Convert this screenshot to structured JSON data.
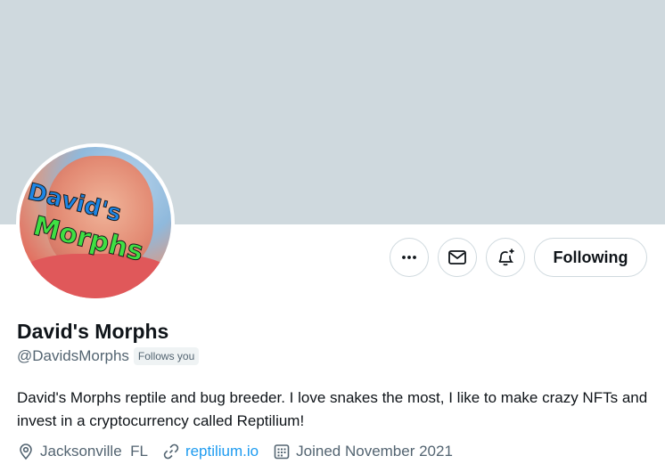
{
  "profile": {
    "display_name": "David's Morphs",
    "handle": "@DavidsMorphs",
    "follows_you_badge": "Follows you",
    "bio": "David's Morphs reptile and bug breeder. I love snakes the most, I like to make crazy NFTs and invest in a cryptocurrency called Reptilium!",
    "location": "Jacksonville  FL",
    "website": "reptilium.io",
    "joined": "Joined November 2021",
    "avatar_text_line1": "David's",
    "avatar_text_line2": "Morphs"
  },
  "actions": {
    "more_icon": "more-horizontal-icon",
    "message_icon": "envelope-icon",
    "notify_icon": "bell-plus-icon",
    "following_label": "Following"
  },
  "meta_icons": {
    "location": "location-pin-icon",
    "website": "link-icon",
    "joined": "calendar-icon"
  },
  "colors": {
    "banner": "#cfd9de",
    "link": "#1d9bf0",
    "secondary_text": "#536471",
    "primary_text": "#0f1419"
  }
}
